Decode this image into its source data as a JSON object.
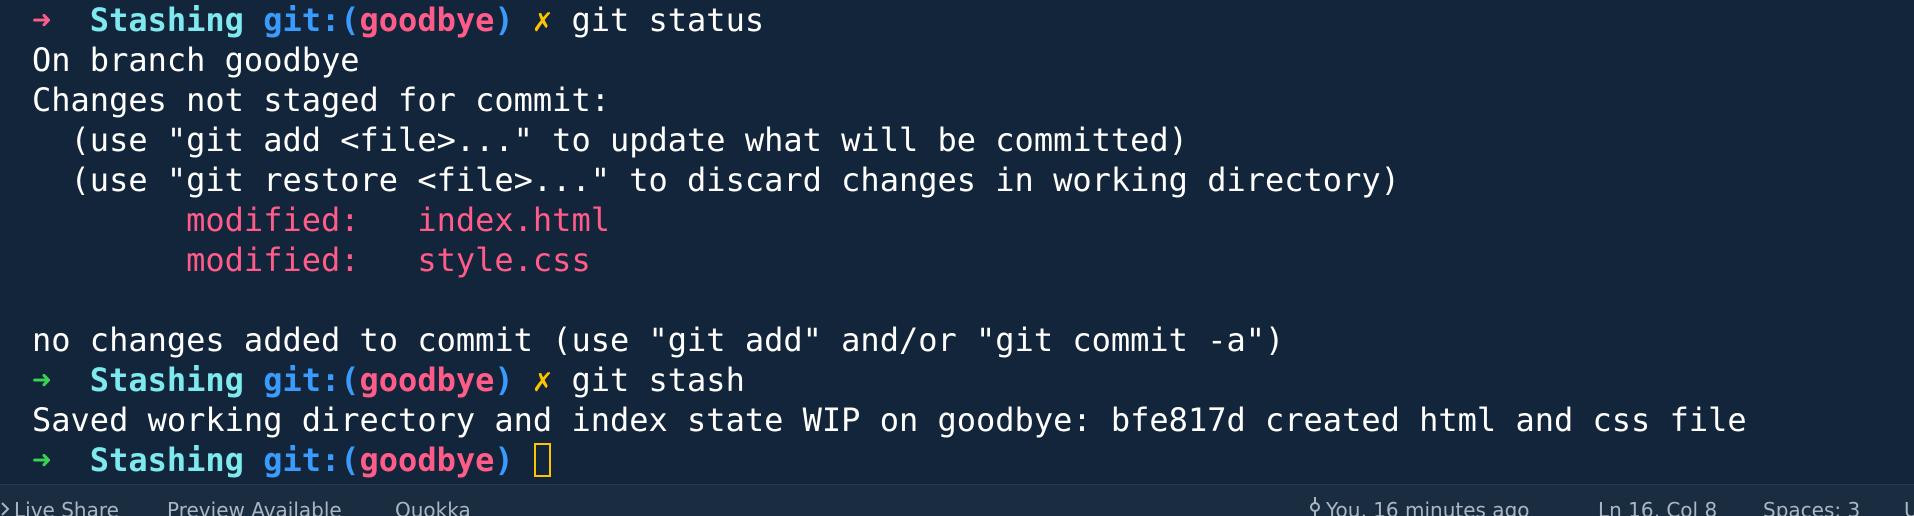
{
  "terminal": {
    "prompt": {
      "arrow": "➜",
      "dir": "Stashing",
      "git_label": "git:(",
      "branch": "goodbye",
      "git_close": ")",
      "dirty_mark": "✗"
    },
    "cmd1": "git status",
    "status_lines": {
      "l1": "On branch goodbye",
      "l2": "Changes not staged for commit:",
      "l3": "  (use \"git add <file>...\" to update what will be committed)",
      "l4": "  (use \"git restore <file>...\" to discard changes in working directory)",
      "mod1_label": "modified:",
      "mod1_file": "index.html",
      "mod2_label": "modified:",
      "mod2_file": "style.css",
      "l5": "no changes added to commit (use \"git add\" and/or \"git commit -a\")"
    },
    "cmd2": "git stash",
    "stash_output": "Saved working directory and index state WIP on goodbye: bfe817d created html and css file"
  },
  "statusbar": {
    "live_share": "Live Share",
    "preview": "Preview Available",
    "quokka": "Quokka",
    "blame": "You, 16 minutes ago",
    "position": "Ln 16, Col 8",
    "spaces": "Spaces: 3"
  },
  "colors": {
    "background": "#13253a",
    "prompt_arrow_error": "#ff5c8a",
    "prompt_arrow_ok": "#39d353",
    "dir": "#7fe9f0",
    "git": "#3a9bff",
    "branch": "#ff5c8a",
    "dirty": "#ffc400",
    "modified": "#ff5c8a"
  }
}
